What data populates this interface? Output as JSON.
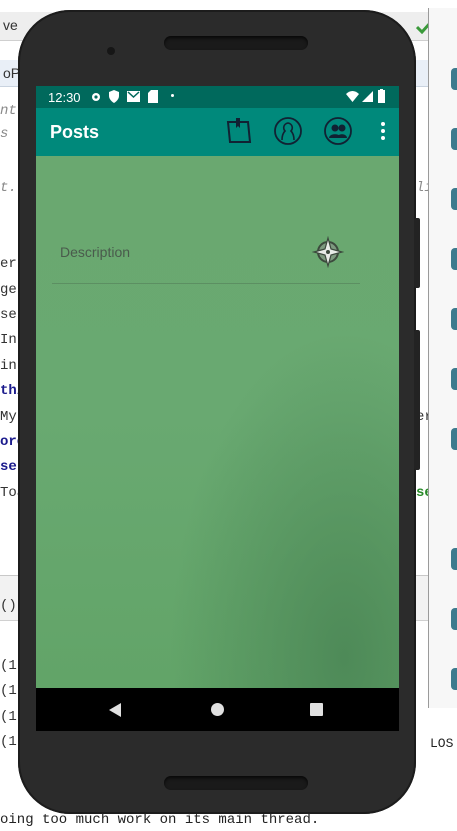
{
  "ide": {
    "tab_fragment": "ve",
    "row_fragment": "oP",
    "code_left": [
      "nt",
      "s",
      "t.r",
      "er",
      "ge",
      "se",
      "Int",
      "int",
      "thi",
      "My",
      "ore",
      "se",
      "Toa"
    ],
    "code_right": [
      "li",
      "er",
      "se"
    ],
    "panel_fragment": "()",
    "log_lines": [
      "(1",
      "(1",
      "(1",
      "(1"
    ],
    "right_log": "LOS",
    "bottom_message": "oing too much work on its main thread."
  },
  "phone": {
    "status_time": "12:30",
    "app_title": "Posts",
    "description_placeholder": "Description",
    "accent_color": "#00897b",
    "status_color": "#00695c"
  }
}
